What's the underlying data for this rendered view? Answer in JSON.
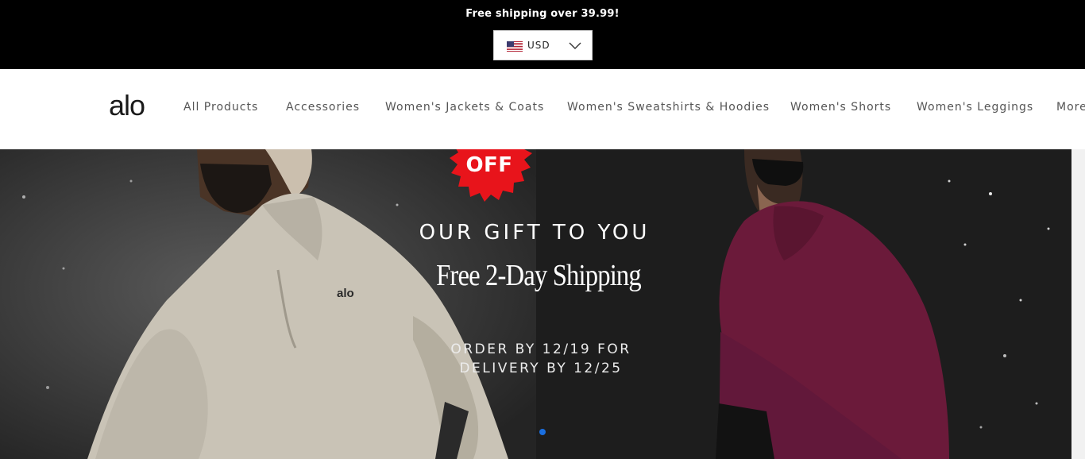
{
  "announcement": {
    "text": "Free shipping over 39.99!",
    "currency": "USD"
  },
  "header": {
    "logo": "alo",
    "nav": [
      "All Products",
      "Accessories",
      "Women's Jackets & Coats",
      "Women's Sweatshirts & Hoodies",
      "Women's Shorts",
      "Women's Leggings",
      "More"
    ]
  },
  "hero": {
    "badge": "OFF",
    "heading": "OUR GIFT TO YOU",
    "subheading": "Free 2-Day Shipping",
    "order_line_1": "ORDER BY 12/19 FOR",
    "order_line_2": "DELIVERY BY 12/25",
    "shirt_logo": "alo",
    "colors": {
      "burst": "#e8141b",
      "active_dot": "#1a6fe0",
      "jacket": "#c9c3b6",
      "hoodie": "#6b1a3a"
    }
  }
}
